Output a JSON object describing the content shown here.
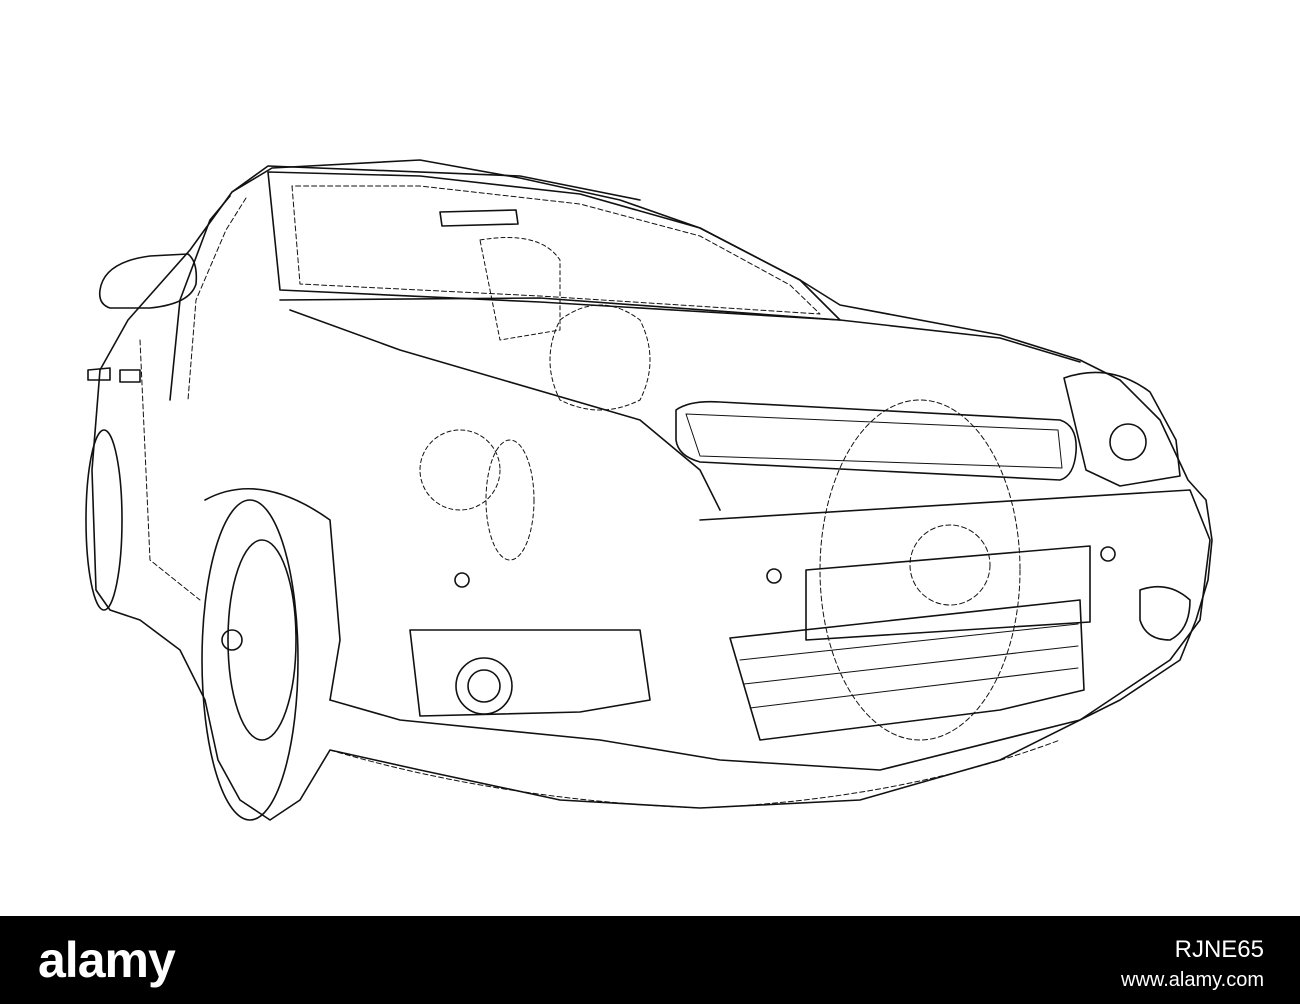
{
  "drawing": {
    "subject": "car-wireframe-sketch",
    "line_color": "#111111",
    "background_color": "#ffffff"
  },
  "banner": {
    "background_color": "#000000",
    "text_color": "#ffffff",
    "logo_text": "alamy",
    "image_id": "RJNE65",
    "site": "www.alamy.com"
  }
}
